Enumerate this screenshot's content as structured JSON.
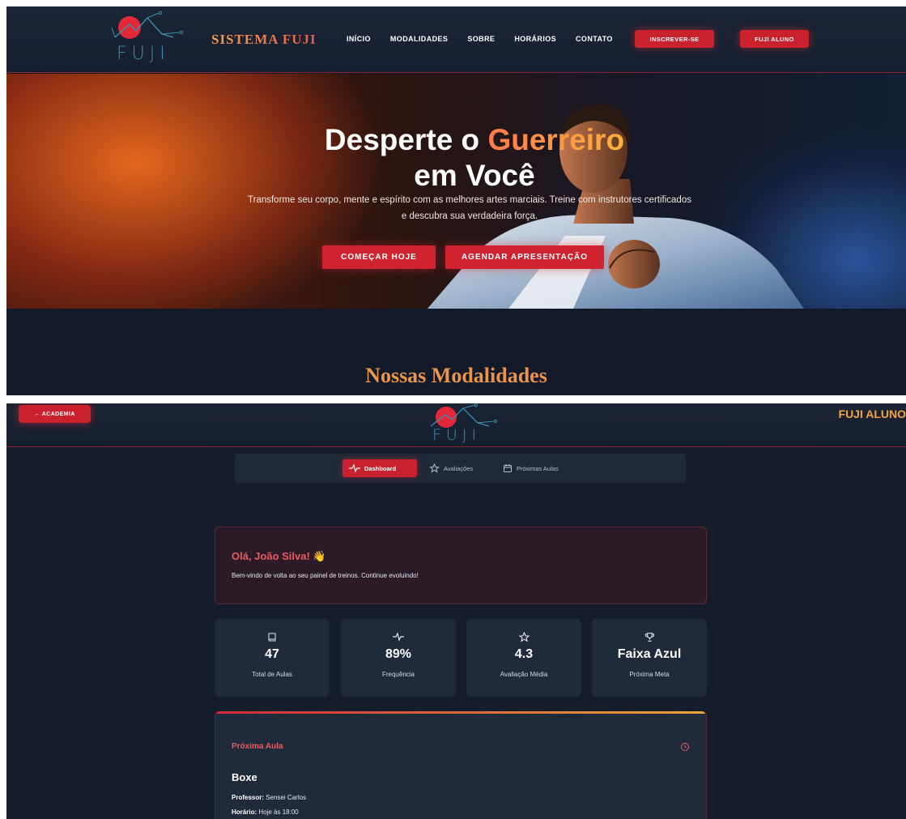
{
  "site": {
    "logo_text": "FUJI",
    "brand": "SISTEMA FUJI",
    "nav": [
      "INÍCIO",
      "MODALIDADES",
      "SOBRE",
      "HORÁRIOS",
      "CONTATO"
    ],
    "cta_primary": "INSCREVER-SE",
    "cta_secondary": "FUJI ALUNO"
  },
  "hero": {
    "title_part1": "Desperte o ",
    "title_accent": "Guerreiro",
    "title_line2": "em Você",
    "subtitle_line1": "Transforme seu corpo, mente e espírito com as melhores artes marciais. Treine com instrutores certificados",
    "subtitle_line2": "e descubra sua verdadeira força.",
    "btn_start": "COMEÇAR HOJE",
    "btn_schedule": "AGENDAR APRESENTAÇÃO"
  },
  "sections": {
    "modalities_title": "Nossas Modalidades"
  },
  "dashboard": {
    "back_button": "← ACADEMIA",
    "logo_text": "FUJI",
    "portal_label": "FUJI ALUNO",
    "tabs": [
      {
        "label": "Dashboard",
        "icon": "activity-icon",
        "active": true
      },
      {
        "label": "Avaliações",
        "icon": "star-icon",
        "active": false
      },
      {
        "label": "Próximas Aulas",
        "icon": "calendar-icon",
        "active": false
      }
    ],
    "welcome_title": "Olá, João Silva! 👋",
    "welcome_text": "Bem-vindo de volta ao seu painel de treinos. Continue evoluindo!",
    "stats": [
      {
        "icon": "book-icon",
        "value": "47",
        "label": "Total de Aulas"
      },
      {
        "icon": "activity-icon",
        "value": "89%",
        "label": "Frequência"
      },
      {
        "icon": "star-icon",
        "value": "4.3",
        "label": "Avaliação Média"
      },
      {
        "icon": "trophy-icon",
        "value": "Faixa Azul",
        "label": "Próxima Meta"
      }
    ],
    "next_class": {
      "title": "Próxima Aula",
      "name": "Boxe",
      "professor_label": "Professor:",
      "professor": " Sensei Carlos",
      "time_label": "Horário:",
      "time": " Hoje às 18:00"
    }
  },
  "colors": {
    "accent_red": "#c9222e",
    "accent_orange": "#f2a33c",
    "bg_dark": "#151c2a"
  }
}
